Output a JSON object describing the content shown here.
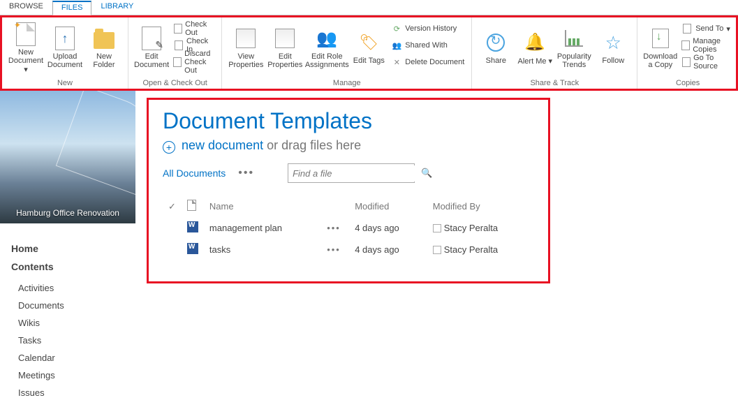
{
  "tabs": {
    "browse": "BROWSE",
    "files": "FILES",
    "library": "LIBRARY"
  },
  "ribbon": {
    "new_doc": "New Document",
    "upload_doc": "Upload Document",
    "new_folder": "New Folder",
    "group_new": "New",
    "edit_doc": "Edit Document",
    "check_out": "Check Out",
    "check_in": "Check In",
    "discard": "Discard Check Out",
    "group_open": "Open & Check Out",
    "view_props": "View Properties",
    "edit_props": "Edit Properties",
    "edit_role": "Edit Role Assignments",
    "edit_tags": "Edit Tags",
    "version_history": "Version History",
    "shared_with": "Shared With",
    "delete_doc": "Delete Document",
    "group_manage": "Manage",
    "share": "Share",
    "alert_me": "Alert Me",
    "pop_trends": "Popularity Trends",
    "follow": "Follow",
    "group_share": "Share & Track",
    "download_copy": "Download a Copy",
    "send_to": "Send To",
    "manage_copies": "Manage Copies",
    "go_to_source": "Go To Source",
    "group_copies": "Copies"
  },
  "site": {
    "caption": "Hamburg Office Renovation"
  },
  "nav": {
    "home": "Home",
    "contents": "Contents",
    "items": [
      "Activities",
      "Documents",
      "Wikis",
      "Tasks",
      "Calendar",
      "Meetings",
      "Issues"
    ]
  },
  "page": {
    "title": "Document Templates",
    "new_document": "new document",
    "drag_hint": "or drag files here",
    "all_docs": "All Documents",
    "search_placeholder": "Find a file"
  },
  "table": {
    "headers": {
      "name": "Name",
      "modified": "Modified",
      "modified_by": "Modified By"
    },
    "rows": [
      {
        "name": "management plan",
        "modified": "4 days ago",
        "by": "Stacy Peralta"
      },
      {
        "name": "tasks",
        "modified": "4 days ago",
        "by": "Stacy Peralta"
      }
    ]
  }
}
